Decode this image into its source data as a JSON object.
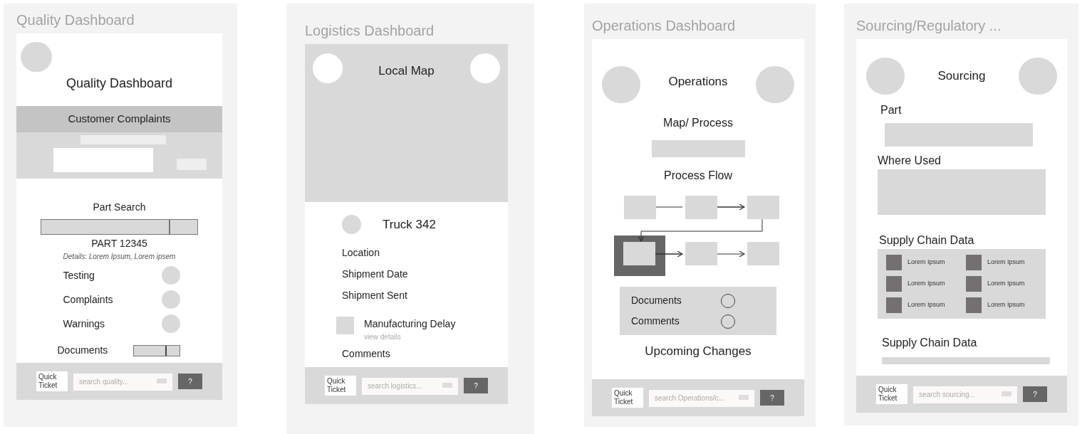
{
  "screens": [
    {
      "kind": "quality",
      "frame_title": "Quality Dashboard",
      "header": "Quality Dashboard",
      "banner": "Customer Complaints",
      "search_label": "Part Search",
      "part_number": "PART 12345",
      "details": "Details: Lorem Ipsum, Lorem ipsem",
      "statuses": [
        "Testing",
        "Complaints",
        "Warnings"
      ],
      "documents": "Documents",
      "footer": {
        "button": "Quick Ticket",
        "placeholder": "search quality...",
        "help": "?"
      }
    },
    {
      "kind": "logistics",
      "frame_title": "Logistics Dashboard",
      "header": "Local Map",
      "truck": "Truck 342",
      "fields": [
        "Location",
        "Shipment Date",
        "Shipment Sent"
      ],
      "alert": {
        "title": "Manufacturing Delay",
        "link": "view details"
      },
      "comments": "Comments",
      "footer": {
        "button": "Quick Ticket",
        "placeholder": "search logistics...",
        "help": "?"
      }
    },
    {
      "kind": "operations",
      "frame_title": "Operations Dashboard",
      "header": "Operations",
      "map_label": "Map/ Process",
      "flow_label": "Process Flow",
      "links": [
        "Documents",
        "Comments"
      ],
      "upcoming": "Upcoming Changes",
      "footer": {
        "button": "Quick Ticket",
        "placeholder": "search Operations/c...",
        "help": "?"
      }
    },
    {
      "kind": "sourcing",
      "frame_title": "Sourcing/Regulatory ...",
      "header": "Sourcing",
      "part_label": "Part",
      "where_used": "Where Used",
      "supply_title": "Supply Chain Data",
      "supply_items": [
        "Lorem Ipsum",
        "Lorem Ipsum",
        "Lorem Ipsum",
        "Lorem Ipsum",
        "Lorem Ipsum",
        "Lorem Ipsum"
      ],
      "supply_title_2": "Supply Chain Data",
      "footer": {
        "button": "Quick Ticket",
        "placeholder": "search sourcing...",
        "help": "?"
      }
    }
  ]
}
